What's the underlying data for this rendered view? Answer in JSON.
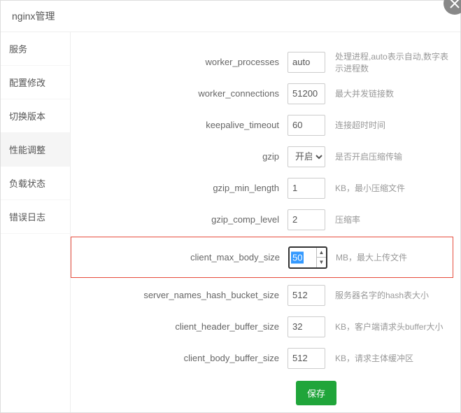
{
  "header": {
    "title": "nginx管理"
  },
  "sidebar": {
    "items": [
      {
        "label": "服务"
      },
      {
        "label": "配置修改"
      },
      {
        "label": "切换版本"
      },
      {
        "label": "性能调整"
      },
      {
        "label": "负载状态"
      },
      {
        "label": "错误日志"
      }
    ],
    "active_index": 3
  },
  "form": {
    "rows": [
      {
        "label": "worker_processes",
        "value": "auto",
        "desc": "处理进程,auto表示自动,数字表示进程数",
        "type": "text"
      },
      {
        "label": "worker_connections",
        "value": "51200",
        "desc": "最大并发链接数",
        "type": "text"
      },
      {
        "label": "keepalive_timeout",
        "value": "60",
        "desc": "连接超时时间",
        "type": "text"
      },
      {
        "label": "gzip",
        "value": "开启",
        "desc": "是否开启压缩传输",
        "type": "select"
      },
      {
        "label": "gzip_min_length",
        "value": "1",
        "desc": "KB，最小压缩文件",
        "type": "text"
      },
      {
        "label": "gzip_comp_level",
        "value": "2",
        "desc": "压缩率",
        "type": "text"
      },
      {
        "label": "client_max_body_size",
        "value": "50",
        "desc": "MB，最大上传文件",
        "type": "spinner",
        "highlight": true
      },
      {
        "label": "server_names_hash_bucket_size",
        "value": "512",
        "desc": "服务器名字的hash表大小",
        "type": "text"
      },
      {
        "label": "client_header_buffer_size",
        "value": "32",
        "desc": "KB，客户端请求头buffer大小",
        "type": "text"
      },
      {
        "label": "client_body_buffer_size",
        "value": "512",
        "desc": "KB，请求主体缓冲区",
        "type": "text"
      }
    ],
    "save_label": "保存"
  }
}
